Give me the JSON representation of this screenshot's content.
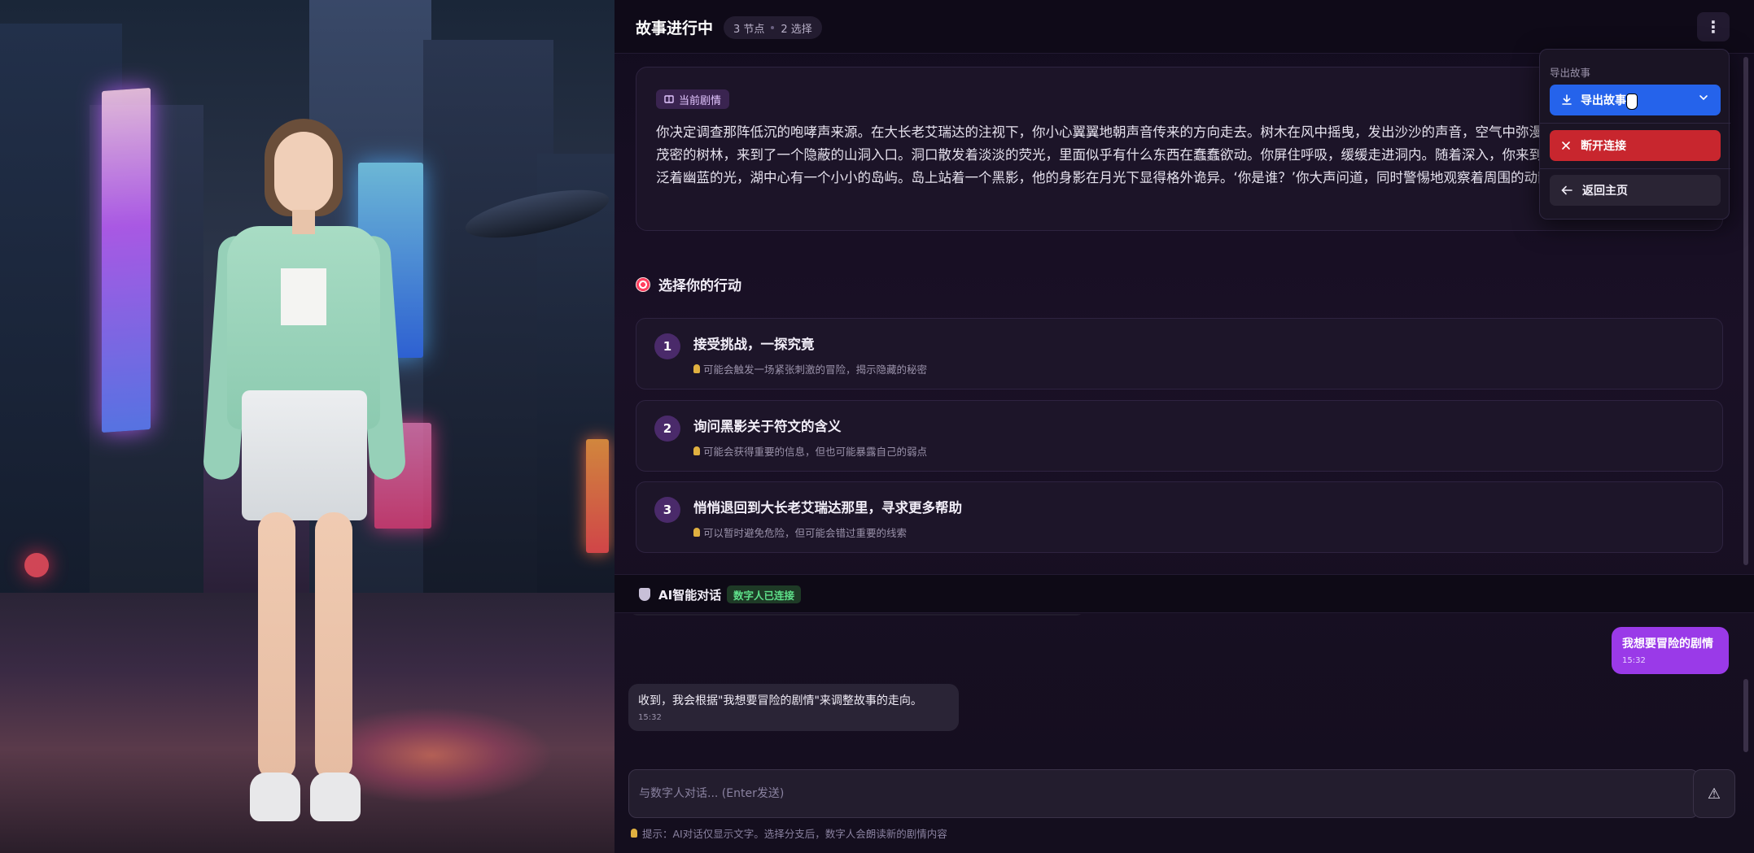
{
  "header": {
    "title": "故事进行中",
    "stats": {
      "nodes": "3 节点",
      "choices": "2 选择"
    },
    "menu_icon": "⋮"
  },
  "story": {
    "badge": "当前剧情",
    "badge_icon": "book-icon",
    "text": "你决定调查那阵低沉的咆哮声来源。在大长老艾瑞达的注视下，你小心翼翼地朝声音传来的方向走去。树木在风中摇曳，发出沙沙的声音，空气中弥漫着一股神秘的气息。你穿过茂密的树林，来到了一个隐蔽的山洞入口。洞口散发着淡淡的荧光，里面似乎有什么东西在蠢蠢欲动。你屏住呼吸，缓缓走进洞内。随着深入，你来到了一个巨大的地下湖。湖水泛着幽蓝的光，湖中心有一个小小的岛屿。岛上站着一个黑影，他的身影在月光下显得格外诡异。‘你是谁？’你大声问道，同时警惕地观察着周围的动静。"
  },
  "choices_section": {
    "title": "选择你的行动",
    "items": [
      {
        "num": "1",
        "label": "接受挑战，一探究竟",
        "hint": "可能会触发一场紧张刺激的冒险，揭示隐藏的秘密"
      },
      {
        "num": "2",
        "label": "询问黑影关于符文的含义",
        "hint": "可能会获得重要的信息，但也可能暴露自己的弱点"
      },
      {
        "num": "3",
        "label": "悄悄退回到大长老艾瑞达那里，寻求更多帮助",
        "hint": "可以暂时避免危险，但可能会错过重要的线索"
      }
    ]
  },
  "chat": {
    "title": "AI智能对话",
    "status": "数字人已连接",
    "messages": [
      {
        "role": "user",
        "text": "我想要冒险的剧情",
        "time": "15:32"
      },
      {
        "role": "bot",
        "text": "收到，我会根据\"我想要冒险的剧情\"来调整故事的走向。",
        "time": "15:32"
      }
    ],
    "input_placeholder": "与数字人对话... (Enter发送)",
    "send_icon": "⚠",
    "tip": "提示：AI对话仅显示文字。选择分支后，数字人会朗读新的剧情内容"
  },
  "dropdown": {
    "heading": "导出故事",
    "export_label": "导出故事",
    "disconnect_label": "断开连接",
    "home_label": "返回主页"
  },
  "colors": {
    "accent_purple": "#9a3ae8",
    "export_blue": "#2563eb",
    "disconnect_red": "#c8262e",
    "connected_green": "#5ee08a"
  }
}
